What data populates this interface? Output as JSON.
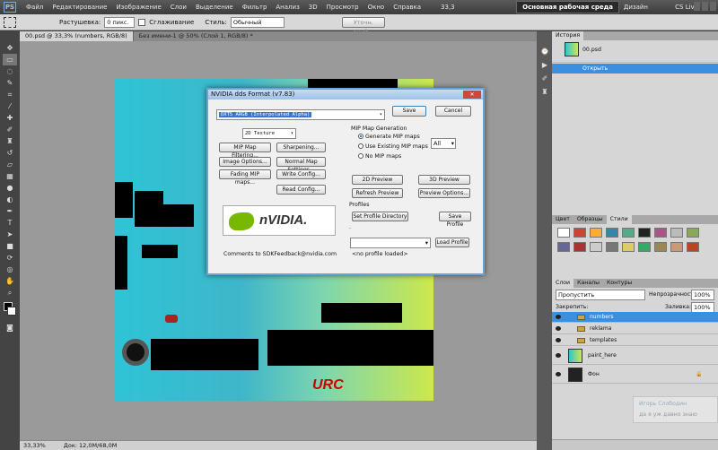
{
  "menubar": {
    "logo": "PS",
    "items": [
      "Файл",
      "Редактирование",
      "Изображение",
      "Слои",
      "Выделение",
      "Фильтр",
      "Анализ",
      "3D",
      "Просмотр",
      "Окно",
      "Справка"
    ],
    "zoom": "33,3",
    "workspace": "Основная рабочая среда",
    "design": "Дизайн",
    "cslive": "CS Live"
  },
  "options": {
    "feather_label": "Растушевка:",
    "feather_value": "0 пикс.",
    "antialias_label": "Сглаживание",
    "style_label": "Стиль:",
    "style_value": "Обычный",
    "refine_button": "Уточн. край..."
  },
  "tabs": {
    "active": "00.psd @ 33,3% (numbers, RGB/8)",
    "inactive": "Без имени-1 @ 50% (Слой 1, RGB/8) *"
  },
  "status": {
    "zoom": "33,33%",
    "doc": "Док: 12,0M/68,0M"
  },
  "dialog": {
    "title": "NVIDIA dds Format (v7.83)",
    "format_value": "DXT5     ARGB     (Interpolated Alpha)",
    "save": "Save",
    "cancel": "Cancel",
    "texture_type": "2D Texture",
    "mip_filtering": "MIP Map Filtering...",
    "sharpening": "Sharpening...",
    "image_options": "Image Options...",
    "normal_map": "Normal Map Settings...",
    "fading": "Fading MIP maps...",
    "write_config": "Write Config...",
    "read_config": "Read Config...",
    "mip_gen_label": "MIP Map Generation",
    "generate": "Generate MIP maps",
    "use_existing": "Use Existing MIP maps",
    "no_mip": "No MIP maps",
    "mip_count": "All",
    "preview2d": "2D Preview",
    "preview3d": "3D Preview",
    "refresh": "Refresh Preview",
    "preview_options": "Preview Options...",
    "profiles_label": "Profiles",
    "set_profile_dir": "Set Profile Directory",
    "save_profile": "Save Profile",
    "profile_dot": ".",
    "load_profile": "Load Profile",
    "no_profile": "<no profile loaded>",
    "comments": "Comments to SDKFeedback@nvidia.com",
    "logo_text": "nVIDIA."
  },
  "history": {
    "tab": "История",
    "snapshot": "00.psd",
    "step": "Открыть"
  },
  "swatch_tabs": [
    "Цвет",
    "Образцы",
    "Стили"
  ],
  "layers_panel": {
    "tabs": [
      "Слои",
      "Каналы",
      "Контуры"
    ],
    "blend": "Пропустить",
    "opacity_label": "Непрозрачность:",
    "opacity_value": "100%",
    "lock_label": "Закрепить:",
    "fill_label": "Заливка:",
    "fill_value": "100%",
    "layers": [
      {
        "name": "numbers",
        "selected": true
      },
      {
        "name": "reklama",
        "selected": false
      },
      {
        "name": "templates",
        "selected": false
      },
      {
        "name": "paint_here",
        "selected": false
      },
      {
        "name": "Фон",
        "selected": false
      }
    ]
  },
  "notification": {
    "name": "Игорь Слободин",
    "text": "да я уж давно знаю"
  },
  "canvas_logo": "URC"
}
